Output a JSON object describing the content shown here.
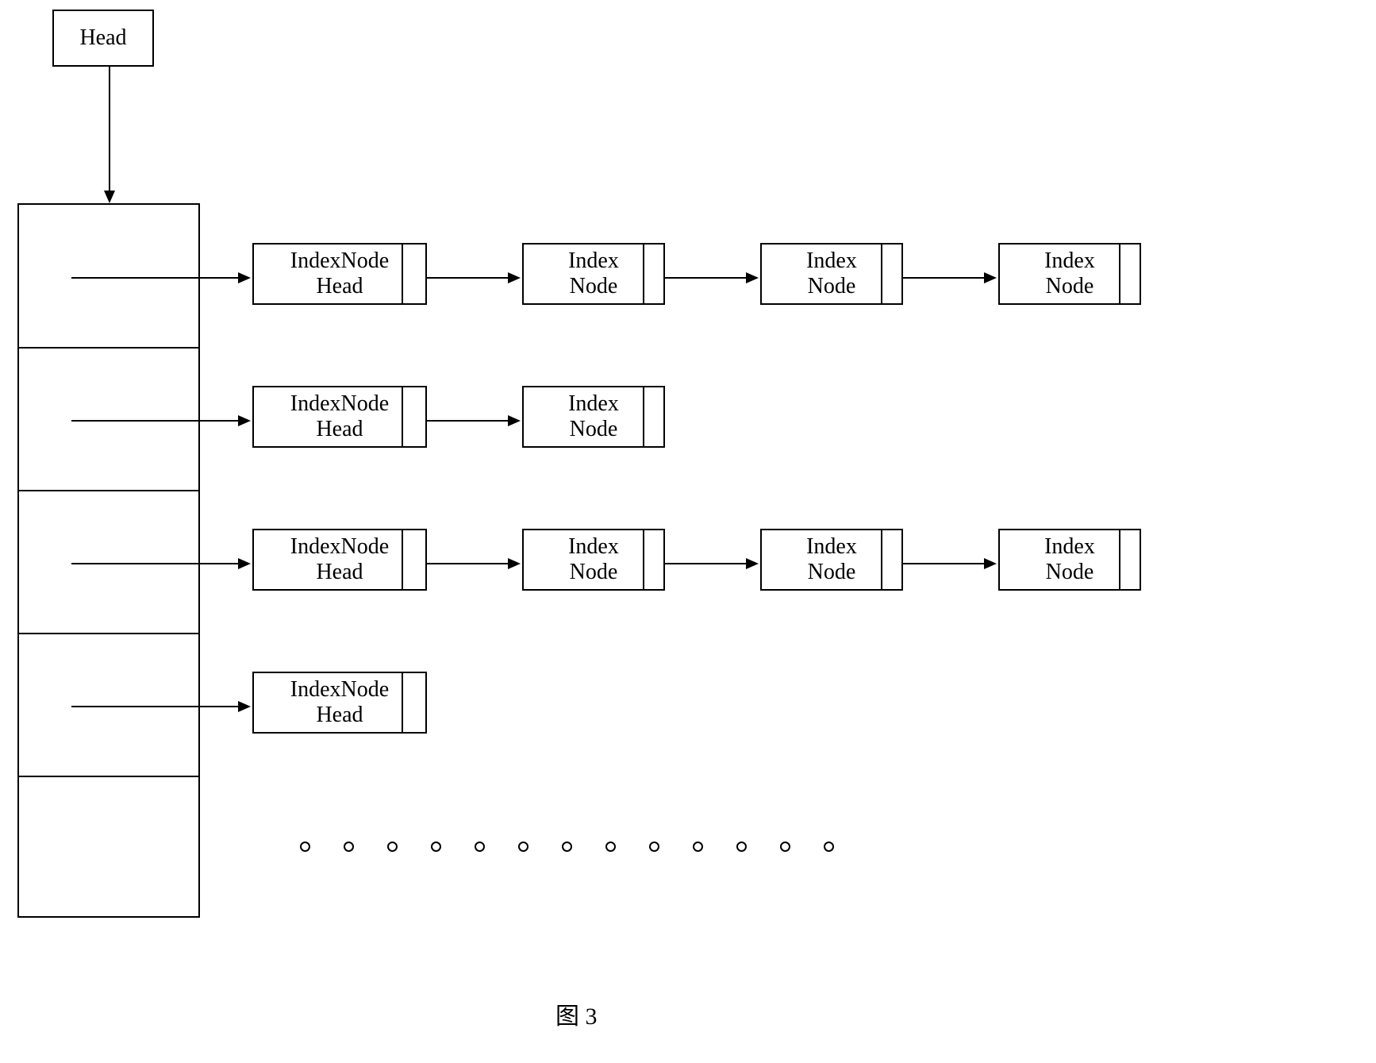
{
  "head": {
    "label": "Head"
  },
  "rows": [
    {
      "headLabel": "IndexNode\nHead",
      "nodes": [
        "Index\nNode",
        "Index\nNode",
        "Index\nNode"
      ]
    },
    {
      "headLabel": "IndexNode\nHead",
      "nodes": [
        "Index\nNode"
      ]
    },
    {
      "headLabel": "IndexNode\nHead",
      "nodes": [
        "Index\nNode",
        "Index\nNode",
        "Index\nNode"
      ]
    },
    {
      "headLabel": "IndexNode\nHead",
      "nodes": []
    }
  ],
  "caption": "图 3"
}
